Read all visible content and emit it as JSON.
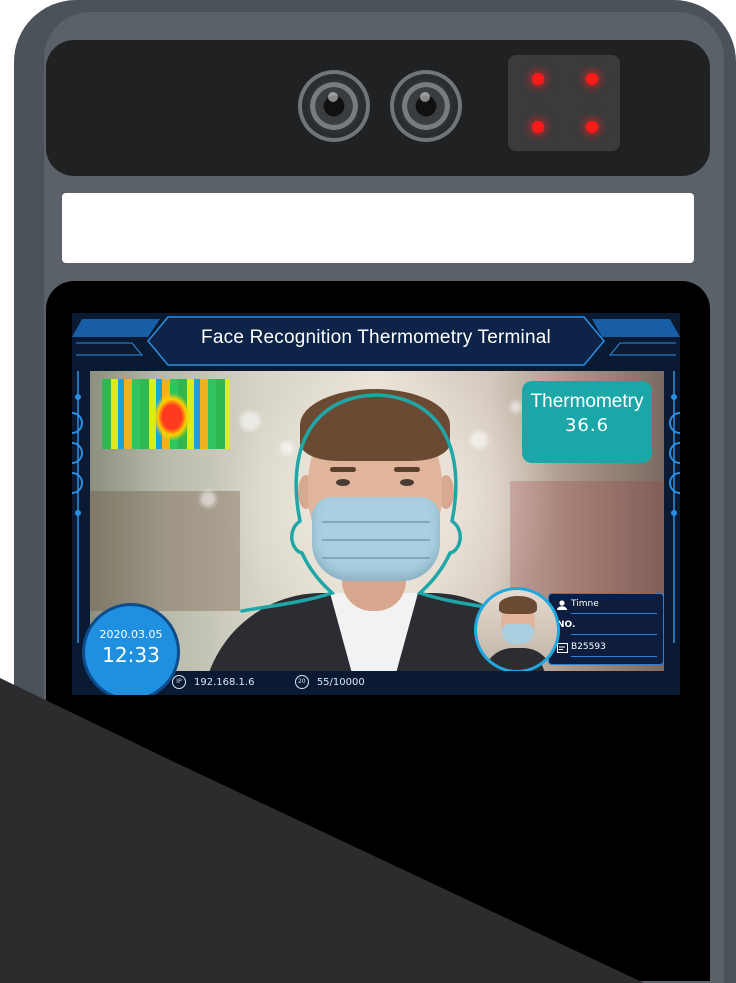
{
  "screen": {
    "title": "Face Recognition Thermometry Terminal",
    "thermometry": {
      "label": "Thermometry",
      "value": "36.6"
    },
    "id_card": {
      "name": "Timne",
      "no_label": "NO.",
      "no_value": "",
      "code": "B25593"
    },
    "clock": {
      "date": "2020.03.05",
      "time": "12:33"
    },
    "footer": {
      "ip_icon": "IP",
      "ip": "192.168.1.6",
      "count_icon": "20",
      "count": "55/10000"
    }
  },
  "colors": {
    "shell": "#4b525a",
    "screen_bg": "#0a1a33",
    "hud_blue": "#1fa7e0",
    "temp_card": "#1ba7a7",
    "ir_led": "#ff1a1a"
  },
  "icons": [
    "camera-lens-icon",
    "ir-led-icon",
    "person-icon",
    "id-card-icon",
    "ip-icon",
    "database-icon"
  ]
}
